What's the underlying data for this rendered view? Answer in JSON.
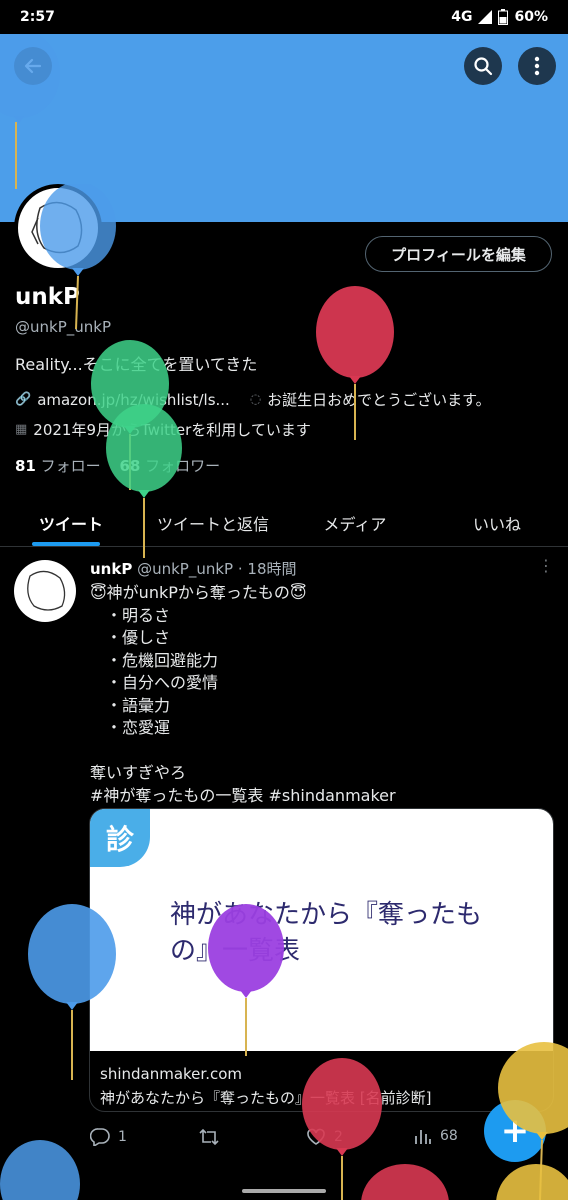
{
  "status": {
    "time": "2:57",
    "network": "4G",
    "battery": "60%"
  },
  "icons": {
    "back": "arrow-left-icon",
    "search": "search-icon",
    "more": "more-vertical-icon"
  },
  "profile": {
    "edit_label": "プロフィールを編集",
    "display_name": "unkP",
    "handle": "@unkP_unkP",
    "bio": "Reality...そこに全てを置いてきた",
    "link": "amazon.jp/hz/wishlist/ls...",
    "birthday": "お誕生日おめでとうございます。",
    "joined": "2021年9月からTwitterを利用しています",
    "following_count": "81",
    "following_label": "フォロー",
    "followers_count": "68",
    "followers_label": "フォロワー"
  },
  "tabs": [
    {
      "label": "ツイート"
    },
    {
      "label": "ツイートと返信"
    },
    {
      "label": "メディア"
    },
    {
      "label": "いいね"
    }
  ],
  "tweet": {
    "name": "unkP",
    "handle": "@unkP_unkP",
    "time": "· 18時間",
    "lines": [
      "😇神がunkPから奪ったもの😇",
      "　・明るさ",
      "　・優しさ",
      "　・危機回避能力",
      "　・自分への愛情",
      "　・語彙力",
      "　・恋愛運",
      "",
      "奪いすぎやろ",
      "#神が奪ったもの一覧表 #shindanmaker"
    ],
    "card": {
      "badge": "診",
      "image_title": "神があなたから『奪ったもの』一覧表",
      "domain": "shindanmaker.com",
      "title": "神があなたから『奪ったもの』一覧表 [名前診断]"
    },
    "replies": "1",
    "likes": "2",
    "views": "68"
  },
  "fab_label": "+",
  "colors": {
    "accent": "#1d9bf0",
    "banner": "#4c9eea",
    "background": "#000000"
  }
}
